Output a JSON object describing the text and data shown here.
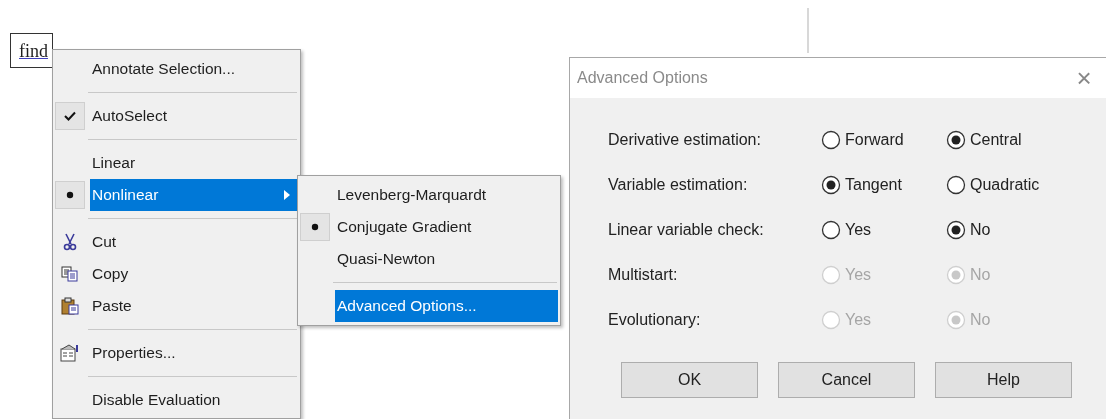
{
  "field": {
    "text": "find"
  },
  "menu": {
    "groups": [
      [
        {
          "label": "Annotate Selection...",
          "kind": "text",
          "selected": false,
          "submenu": false
        }
      ],
      [
        {
          "label": "AutoSelect",
          "kind": "check",
          "selected": false,
          "submenu": false
        }
      ],
      [
        {
          "label": "Linear",
          "kind": "text",
          "selected": false,
          "submenu": false
        },
        {
          "label": "Nonlinear",
          "kind": "dot",
          "selected": true,
          "submenu": true
        }
      ],
      [
        {
          "label": "Cut",
          "kind": "icon",
          "selected": false,
          "submenu": false
        },
        {
          "label": "Copy",
          "kind": "icon",
          "selected": false,
          "submenu": false
        },
        {
          "label": "Paste",
          "kind": "icon",
          "selected": false,
          "submenu": false
        }
      ],
      [
        {
          "label": "Properties...",
          "kind": "icon",
          "selected": false,
          "submenu": false
        }
      ],
      [
        {
          "label": "Disable Evaluation",
          "kind": "text",
          "selected": false,
          "submenu": false
        }
      ]
    ]
  },
  "submenu": {
    "groups": [
      [
        {
          "label": "Levenberg-Marquardt",
          "kind": "text",
          "selected": false
        },
        {
          "label": "Conjugate Gradient",
          "kind": "dot",
          "selected": false
        },
        {
          "label": "Quasi-Newton",
          "kind": "text",
          "selected": false
        }
      ],
      [
        {
          "label": "Advanced Options...",
          "kind": "text",
          "selected": true
        }
      ]
    ]
  },
  "dialog": {
    "title": "Advanced Options",
    "close": "×",
    "rows": [
      {
        "label": "Derivative estimation:",
        "disabled": false,
        "options": [
          {
            "label": "Forward",
            "selected": false
          },
          {
            "label": "Central",
            "selected": true
          }
        ]
      },
      {
        "label": "Variable estimation:",
        "disabled": false,
        "options": [
          {
            "label": "Tangent",
            "selected": true
          },
          {
            "label": "Quadratic",
            "selected": false
          }
        ]
      },
      {
        "label": "Linear variable check:",
        "disabled": false,
        "options": [
          {
            "label": "Yes",
            "selected": false
          },
          {
            "label": "No",
            "selected": true
          }
        ]
      },
      {
        "label": "Multistart:",
        "disabled": true,
        "options": [
          {
            "label": "Yes",
            "selected": false
          },
          {
            "label": "No",
            "selected": true
          }
        ]
      },
      {
        "label": "Evolutionary:",
        "disabled": true,
        "options": [
          {
            "label": "Yes",
            "selected": false
          },
          {
            "label": "No",
            "selected": true
          }
        ]
      }
    ],
    "buttons": [
      "OK",
      "Cancel",
      "Help"
    ]
  }
}
